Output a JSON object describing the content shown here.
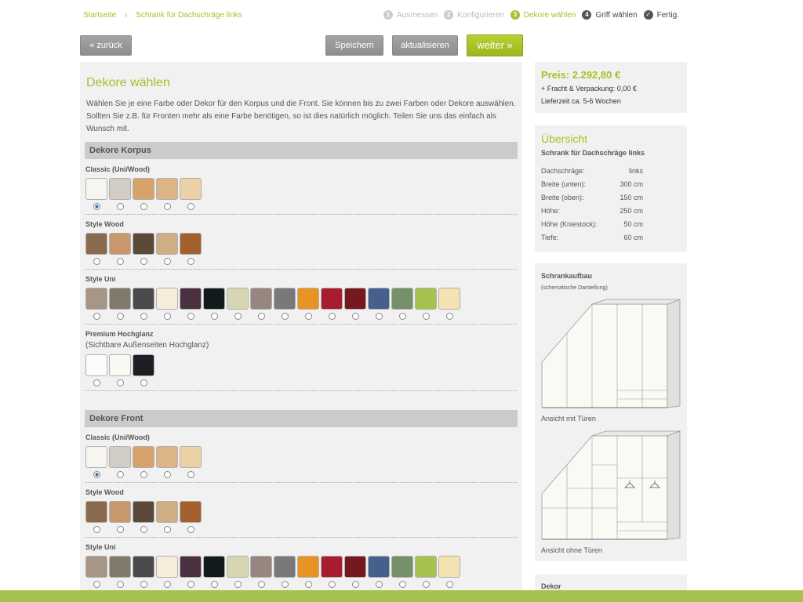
{
  "breadcrumb": {
    "home": "Startseite",
    "current": "Schrank für Dachschräge links"
  },
  "steps": [
    {
      "num": "1",
      "label": "Ausmessen",
      "state": "done"
    },
    {
      "num": "2",
      "label": "Konfigurieren",
      "state": "done"
    },
    {
      "num": "3",
      "label": "Dekore wählen",
      "state": "active"
    },
    {
      "num": "4",
      "label": "Griff wählen",
      "state": "next"
    },
    {
      "num": "✓",
      "label": "Fertig.",
      "state": "next"
    }
  ],
  "buttons": {
    "back": "« zurück",
    "save": "Speichern",
    "update": "aktualisieren",
    "next": "weiter »"
  },
  "main": {
    "title": "Dekore wählen",
    "intro": "Wählen Sie je eine Farbe oder Dekor für den Korpus und die Front. Sie können bis zu zwei Farben oder Dekore auswählen. Sollten Sie z.B. für Fronten mehr als eine Farbe benötigen, so ist dies natürlich möglich. Teilen Sie uns das einfach als Wunsch mit.",
    "korpus_title": "Dekore Korpus",
    "front_title": "Dekore Front",
    "classic_label": "Classic (Uni/Wood)",
    "wood_label": "Style Wood",
    "uni_label": "Style Uni",
    "premium_label": "Premium Hochglanz",
    "premium_sub": "(Sichtbare Außenseiten Hochglanz)"
  },
  "swatches": {
    "classic": [
      "#f7f5f0",
      "#d2cdc6",
      "#d8a26c",
      "#dcb486",
      "#ecd1a6"
    ],
    "wood": [
      "#8a6a4d",
      "#c8986c",
      "#5a4a3a",
      "#ceae84",
      "#a2602e"
    ],
    "uni": [
      "#a79585",
      "#807a6c",
      "#4a4a4a",
      "#f7ecdc",
      "#4a3040",
      "#121a1e",
      "#d8d6b2",
      "#968680",
      "#7a7878",
      "#e89424",
      "#a81c2e",
      "#761820",
      "#46608e",
      "#76906a",
      "#a6c24e",
      "#f4e2b0"
    ],
    "premium": [
      "#fbfbfb",
      "#faf8f2",
      "#1c2024"
    ]
  },
  "sidebar": {
    "price": "Preis: 2.292,80 €",
    "shipping": "+ Fracht & Verpackung: 0,00 €",
    "delivery": "Lieferzeit ca. 5-6 Wochen",
    "overview_title": "Übersicht",
    "overview_sub": "Schrank für Dachschräge links",
    "specs": [
      {
        "label": "Dachschräge:",
        "value": "links"
      },
      {
        "label": "Breite (unten):",
        "value": "300 cm"
      },
      {
        "label": "Breite (oben):",
        "value": "150 cm"
      },
      {
        "label": "Höhe:",
        "value": "250 cm"
      },
      {
        "label": "Höhe (Kniestock):",
        "value": "50 cm"
      },
      {
        "label": "Tiefe:",
        "value": "60 cm"
      }
    ],
    "build_title": "Schrankaufbau",
    "build_sub": "(schematische Darstellung)",
    "cap_doors": "Ansicht mit Türen",
    "cap_nodoors": "Ansicht ohne Türen",
    "dekor_title": "Dekor"
  }
}
